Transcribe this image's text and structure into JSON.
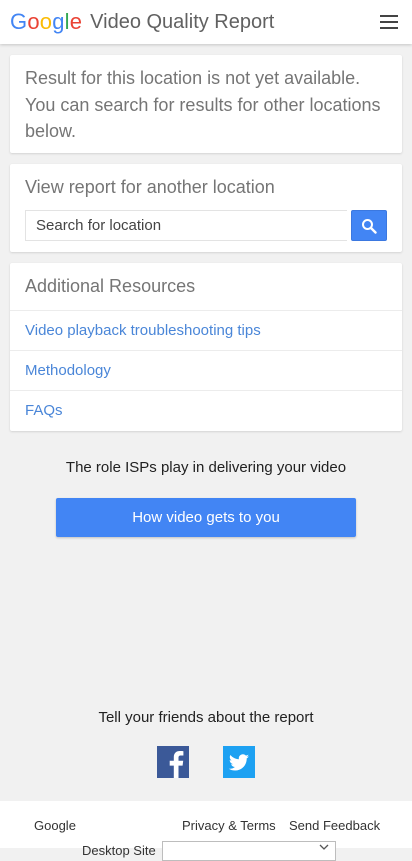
{
  "header": {
    "logo_letters": [
      "G",
      "o",
      "o",
      "g",
      "l",
      "e"
    ],
    "logo_colors": [
      "#4285f4",
      "#ea4335",
      "#fbbc05",
      "#4285f4",
      "#34a853",
      "#ea4335"
    ],
    "product_title": "Video Quality Report",
    "menu_icon": "hamburger-menu-icon"
  },
  "status_card": {
    "message": "Result for this location is not yet available. You can search for results for other locations below."
  },
  "search_card": {
    "title": "View report for another location",
    "input_placeholder": "Search for location",
    "input_value": "",
    "button_icon": "search-icon"
  },
  "resources_card": {
    "title": "Additional Resources",
    "links": [
      "Video playback troubleshooting tips",
      "Methodology",
      "FAQs"
    ]
  },
  "isp_section": {
    "text": "The role ISPs play in delivering your video",
    "button_label": "How video gets to you"
  },
  "share_section": {
    "text": "Tell your friends about the report",
    "icons": [
      "facebook-icon",
      "twitter-icon"
    ]
  },
  "footer": {
    "google_link": "Google",
    "privacy_link": "Privacy & Terms",
    "feedback_link": "Send Feedback",
    "desktop_label": "Desktop Site",
    "language_select_value": ""
  },
  "colors": {
    "accent_blue": "#4285f4",
    "link_blue": "#4a86d8",
    "facebook": "#3b5998",
    "twitter": "#1da1f2",
    "background": "#f1f1f1"
  }
}
